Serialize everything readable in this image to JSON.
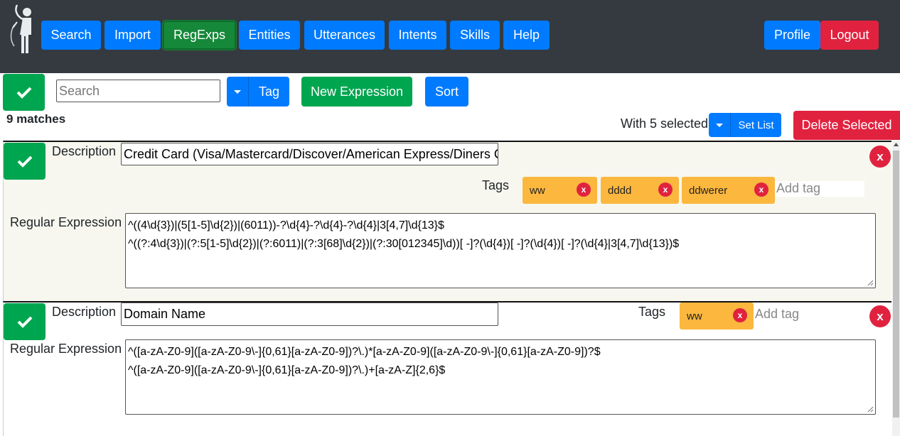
{
  "nav": {
    "items": [
      "Search",
      "Import",
      "RegExps",
      "Entities",
      "Utterances",
      "Intents",
      "Skills",
      "Help"
    ],
    "active": "RegExps",
    "profile": "Profile",
    "logout": "Logout"
  },
  "toolbar": {
    "search_placeholder": "Search",
    "tag_label": "Tag",
    "new_expression": "New Expression",
    "sort": "Sort",
    "matches": "9 matches",
    "with_selected": "With 5 selected",
    "set_list": "Set List",
    "delete_selected": "Delete Selected"
  },
  "entries": [
    {
      "description_label": "Description",
      "description": "Credit Card (Visa/Mastercard/Discover/American Express/Diners C",
      "tags_label": "Tags",
      "tags": [
        "ww",
        "dddd",
        "ddwerer"
      ],
      "add_tag_placeholder": "Add tag",
      "regex_label": "Regular Expression",
      "regex_lines": [
        "^((4\\d{3})|(5[1-5]\\d{2})|(6011))-?\\d{4}-?\\d{4}-?\\d{4}|3[4,7]\\d{13}$",
        "^((?:4\\d{3})|(?:5[1-5]\\d{2})|(?:6011)|(?:3[68]\\d{2})|(?:30[012345]\\d))[ -]?(\\d{4})[ -]?(\\d{4})[ -]?(\\d{4}|3[4,7]\\d{13})$"
      ]
    },
    {
      "description_label": "Description",
      "description": "Domain Name",
      "tags_label": "Tags",
      "tags": [
        "ww"
      ],
      "add_tag_placeholder": "Add tag",
      "regex_label": "Regular Expression",
      "regex_lines": [
        "^([a-zA-Z0-9]([a-zA-Z0-9\\-]{0,61}[a-zA-Z0-9])?\\.)*[a-zA-Z0-9]([a-zA-Z0-9\\-]{0,61}[a-zA-Z0-9])?$",
        "^([a-zA-Z0-9]([a-zA-Z0-9\\-]{0,61}[a-zA-Z0-9])?\\.)+[a-zA-Z]{2,6}$"
      ]
    }
  ],
  "tag_remove_symbol": "x",
  "entry_remove_symbol": "x",
  "colors": {
    "navbar": "#343a40",
    "primary": "#007bff",
    "success": "#00a54f",
    "danger": "#e0223f",
    "tag": "#fbb73e"
  }
}
